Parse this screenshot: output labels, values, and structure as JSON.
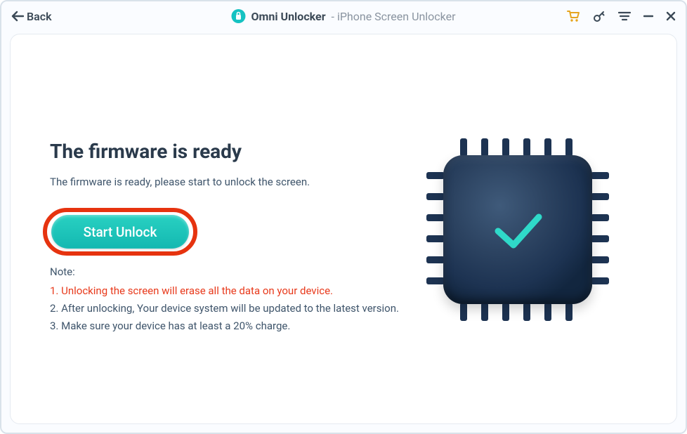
{
  "titlebar": {
    "back_label": "Back",
    "app_name": "Omni Unlocker",
    "app_subtitle": " - iPhone Screen Unlocker"
  },
  "main": {
    "heading": "The firmware is ready",
    "subtitle": "The firmware is ready, please start to unlock the screen.",
    "start_button_label": "Start Unlock",
    "note_label": "Note:",
    "note_1": "1. Unlocking the screen will erase all the data on your device.",
    "note_2": "2. After unlocking, Your device system will be updated to the latest version.",
    "note_3": "3. Make sure your device has at least a 20% charge."
  }
}
